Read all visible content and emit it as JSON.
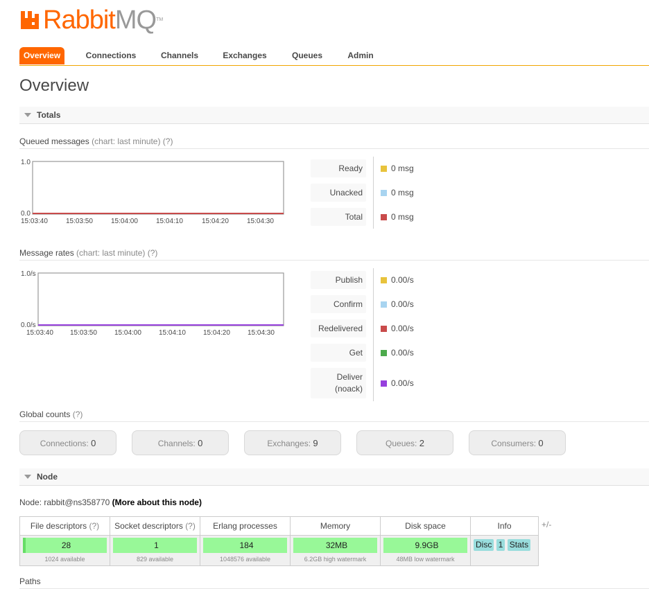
{
  "brand": {
    "logo_main": "Rabbit",
    "logo_accent": "MQ",
    "trademark": "TM",
    "color": "#ff6600"
  },
  "nav": {
    "tabs": [
      {
        "label": "Overview",
        "active": true
      },
      {
        "label": "Connections",
        "active": false
      },
      {
        "label": "Channels",
        "active": false
      },
      {
        "label": "Exchanges",
        "active": false
      },
      {
        "label": "Queues",
        "active": false
      },
      {
        "label": "Admin",
        "active": false
      }
    ]
  },
  "page_title": "Overview",
  "totals": {
    "header": "Totals",
    "queued": {
      "title": "Queued messages",
      "hint": "(chart: last minute)",
      "help": "(?)",
      "y_top": "1.0",
      "y_bottom": "0.0",
      "x_ticks": [
        "15:03:40",
        "15:03:50",
        "15:04:00",
        "15:04:10",
        "15:04:20",
        "15:04:30"
      ],
      "legend": [
        {
          "label": "Ready",
          "value": "0 msg",
          "color": "#e8c33c"
        },
        {
          "label": "Unacked",
          "value": "0 msg",
          "color": "#a8d4f0"
        },
        {
          "label": "Total",
          "value": "0 msg",
          "color": "#c94b4b"
        }
      ]
    },
    "rates": {
      "title": "Message rates",
      "hint": "(chart: last minute)",
      "help": "(?)",
      "y_top": "1.0/s",
      "y_bottom": "0.0/s",
      "x_ticks": [
        "15:03:40",
        "15:03:50",
        "15:04:00",
        "15:04:10",
        "15:04:20",
        "15:04:30"
      ],
      "legend": [
        {
          "label": "Publish",
          "value": "0.00/s",
          "color": "#e8c33c"
        },
        {
          "label": "Confirm",
          "value": "0.00/s",
          "color": "#a8d4f0"
        },
        {
          "label": "Redelivered",
          "value": "0.00/s",
          "color": "#c94b4b"
        },
        {
          "label": "Get",
          "value": "0.00/s",
          "color": "#4caa4c"
        },
        {
          "label": "Deliver",
          "label2": "(noack)",
          "value": "0.00/s",
          "color": "#9640dd"
        }
      ]
    },
    "global_counts": {
      "title": "Global counts",
      "help": "(?)",
      "items": [
        {
          "label": "Connections:",
          "value": "0"
        },
        {
          "label": "Channels:",
          "value": "0"
        },
        {
          "label": "Exchanges:",
          "value": "9"
        },
        {
          "label": "Queues:",
          "value": "2"
        },
        {
          "label": "Consumers:",
          "value": "0"
        }
      ]
    }
  },
  "node": {
    "header": "Node",
    "prefix": "Node:",
    "name": "rabbit@ns358770",
    "more_link": "(More about this node)",
    "columns": {
      "fd": "File descriptors",
      "fd_help": "(?)",
      "sd": "Socket descriptors",
      "sd_help": "(?)",
      "erl": "Erlang processes",
      "mem": "Memory",
      "disk": "Disk space",
      "info": "Info"
    },
    "values": {
      "fd": "28",
      "fd_sub": "1024 available",
      "sd": "1",
      "sd_sub": "829 available",
      "erl": "184",
      "erl_sub": "1048576 available",
      "mem": "32MB",
      "mem_sub": "6.2GB high watermark",
      "disk": "9.9GB",
      "disk_sub": "48MB low watermark"
    },
    "info_tags": [
      "Disc",
      "1",
      "Stats"
    ],
    "plus_minus": "+/-"
  },
  "paths": {
    "title": "Paths"
  }
}
